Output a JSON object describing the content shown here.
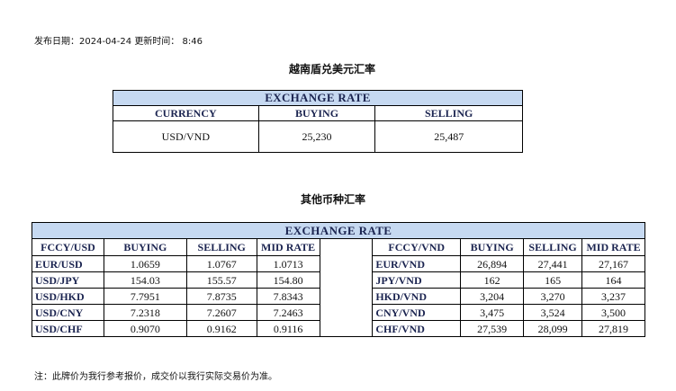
{
  "publish": {
    "date_label": "发布日期：",
    "date": "2024-04-24",
    "update_label": "更新时间：",
    "time": "8:46"
  },
  "main": {
    "title": "越南盾兑美元汇率",
    "header": "EXCHANGE RATE",
    "columns": [
      "CURRENCY",
      "BUYING",
      "SELLING"
    ],
    "row": {
      "currency": "USD/VND",
      "buying": "25,230",
      "selling": "25,487"
    }
  },
  "other": {
    "title": "其他币种汇率",
    "header": "EXCHANGE  RATE",
    "left_columns": [
      "FCCY/USD",
      "BUYING",
      "SELLING",
      "MID RATE"
    ],
    "right_columns": [
      "FCCY/VND",
      "BUYING",
      "SELLING",
      "MID RATE"
    ],
    "left_rows": [
      {
        "pair": "EUR/USD",
        "buying": "1.0659",
        "selling": "1.0767",
        "mid": "1.0713"
      },
      {
        "pair": "USD/JPY",
        "buying": "154.03",
        "selling": "155.57",
        "mid": "154.80"
      },
      {
        "pair": "USD/HKD",
        "buying": "7.7951",
        "selling": "7.8735",
        "mid": "7.8343"
      },
      {
        "pair": "USD/CNY",
        "buying": "7.2318",
        "selling": "7.2607",
        "mid": "7.2463"
      },
      {
        "pair": "USD/CHF",
        "buying": "0.9070",
        "selling": "0.9162",
        "mid": "0.9116"
      }
    ],
    "right_rows": [
      {
        "pair": "EUR/VND",
        "buying": "26,894",
        "selling": "27,441",
        "mid": "27,167"
      },
      {
        "pair": "JPY/VND",
        "buying": "162",
        "selling": "165",
        "mid": "164"
      },
      {
        "pair": "HKD/VND",
        "buying": "3,204",
        "selling": "3,270",
        "mid": "3,237"
      },
      {
        "pair": "CNY/VND",
        "buying": "3,475",
        "selling": "3,524",
        "mid": "3,500"
      },
      {
        "pair": "CHF/VND",
        "buying": "27,539",
        "selling": "28,099",
        "mid": "27,819"
      }
    ]
  },
  "note": "注：此牌价为我行参考报价，成交价以我行实际交易价为准。"
}
